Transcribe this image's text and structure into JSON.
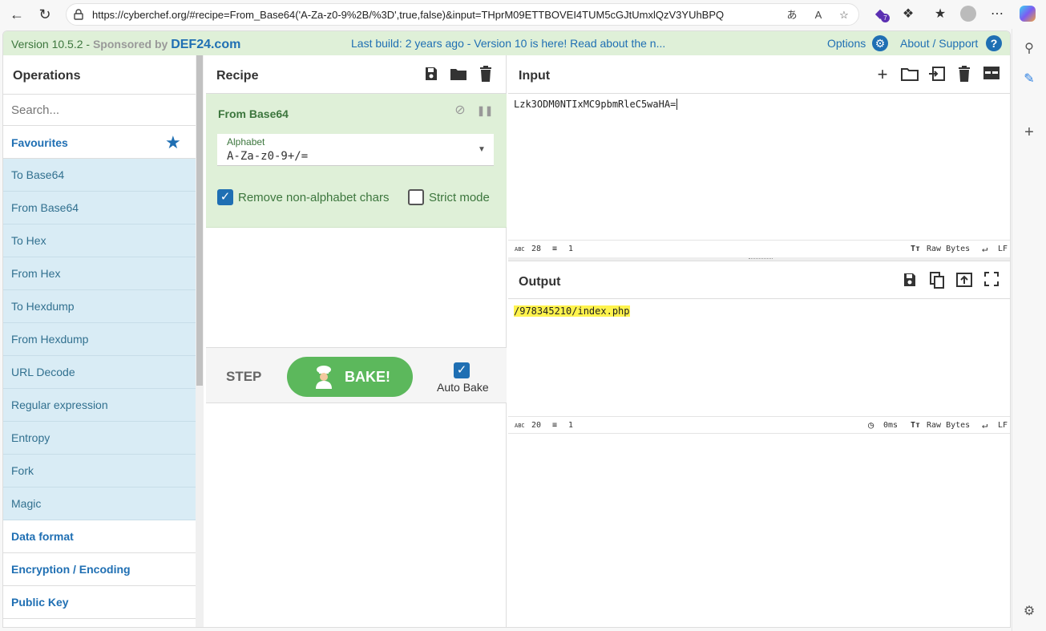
{
  "browser": {
    "url": "https://cyberchef.org/#recipe=From_Base64('A-Za-z0-9%2B/%3D',true,false)&input=THprM09ETTBOVEI4TUM5cGJtUmxlQzV3YUhBPQ",
    "extension_badge": "7"
  },
  "banner": {
    "version_prefix": "Version 10.5.2 - ",
    "sponsored": "Sponsored by ",
    "sponsor": "DEF24.com",
    "build": "Last build: 2 years ago - Version 10 is here! Read about the n...",
    "options": "Options",
    "about": "About / Support",
    "help": "?"
  },
  "operations": {
    "title": "Operations",
    "search_placeholder": "Search...",
    "favourites": "Favourites",
    "items": [
      "To Base64",
      "From Base64",
      "To Hex",
      "From Hex",
      "To Hexdump",
      "From Hexdump",
      "URL Decode",
      "Regular expression",
      "Entropy",
      "Fork",
      "Magic"
    ],
    "categories": [
      "Data format",
      "Encryption / Encoding",
      "Public Key"
    ]
  },
  "recipe": {
    "title": "Recipe",
    "operation": {
      "name": "From Base64",
      "alphabet_label": "Alphabet",
      "alphabet_value": "A-Za-z0-9+/=",
      "remove_label": "Remove non-alphabet chars",
      "strict_label": "Strict mode"
    },
    "step": "STEP",
    "bake": "BAKE!",
    "auto_bake": "Auto Bake"
  },
  "input": {
    "title": "Input",
    "text": "Lzk3ODM0NTIxMC9pbmRleC5waHA=",
    "length": "28",
    "lines": "1",
    "encoding": "Raw Bytes",
    "eol": "LF"
  },
  "output": {
    "title": "Output",
    "text": "/978345210/index.php",
    "length": "20",
    "lines": "1",
    "time": "0ms",
    "encoding": "Raw Bytes",
    "eol": "LF"
  },
  "colors": {
    "accent": "#1f6fb3",
    "recipe_bg": "#dff0d8",
    "favourite_bg": "#d9ecf5",
    "bake": "#5cb85c"
  }
}
